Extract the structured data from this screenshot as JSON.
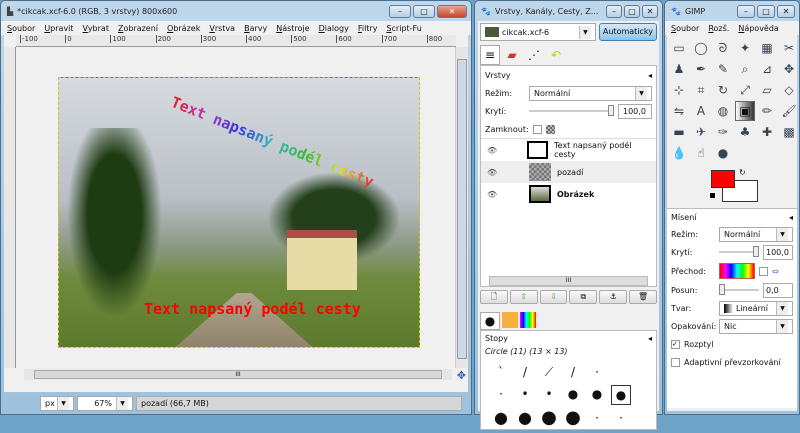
{
  "image_window": {
    "title": "*cikcak.xcf-6.0 (RGB, 3 vrstvy) 800x600",
    "menu": [
      "Soubor",
      "Upravit",
      "Vybrat",
      "Zobrazení",
      "Obrázek",
      "Vrstva",
      "Barvy",
      "Nástroje",
      "Dialogy",
      "Filtry",
      "Script-Fu"
    ],
    "ruler_labels": [
      "-100",
      "0",
      "100",
      "200",
      "300",
      "400",
      "500",
      "600",
      "700",
      "800"
    ],
    "canvas_text_arc": "Text napsaný podél cesty",
    "canvas_text_line": "Text napsaný podél cesty",
    "unit": "px",
    "zoom": "67%",
    "status": "pozadí (66,7 MB)"
  },
  "layers_window": {
    "title": "Vrstvy, Kanály, Cesty, Z...",
    "image_select": "cikcak.xcf-6",
    "auto_button": "Automaticky",
    "section": "Vrstvy",
    "mode_label": "Režim:",
    "mode": "Normální",
    "opacity_label": "Krytí:",
    "opacity": "100,0",
    "lock_label": "Zamknout:",
    "layers": [
      {
        "name": "Text napsaný podél cesty",
        "bold": false
      },
      {
        "name": "pozadí",
        "bold": false
      },
      {
        "name": "Obrázek",
        "bold": true
      }
    ],
    "brushes_title": "Stopy",
    "brush_name": "Circle (11) (13 × 13)"
  },
  "toolbox": {
    "title": "GIMP",
    "menu": [
      "Soubor",
      "Rozš.",
      "Nápověda"
    ],
    "fg_color": "#ff0000",
    "bg_color": "#ffffff",
    "tools": [
      "rect-select",
      "ellipse-select",
      "free-select",
      "fuzzy-select",
      "select-by-color",
      "scissors",
      "foreground-select",
      "paths",
      "color-picker",
      "zoom",
      "measure",
      "move",
      "align",
      "crop",
      "rotate",
      "scale",
      "shear",
      "perspective",
      "flip",
      "text",
      "bucket-fill",
      "blend",
      "pencil",
      "paintbrush",
      "eraser",
      "airbrush",
      "ink",
      "clone",
      "heal",
      "perspective-clone",
      "blur",
      "smudge",
      "dodge-burn"
    ],
    "tool_glyphs": [
      "▭",
      "◯",
      "ᘐ",
      "✦",
      "▦",
      "✂",
      "♟",
      "✒",
      "✎",
      "⌕",
      "⊿",
      "✥",
      "⊹",
      "⌗",
      "↻",
      "⤢",
      "▱",
      "◇",
      "⇋",
      "A",
      "◍",
      "▣",
      "✏",
      "🖌",
      "▬",
      "✈",
      "✑",
      "♣",
      "✚",
      "▩",
      "💧",
      "☝",
      "●"
    ],
    "options_title": "Mísení",
    "mode_label": "Režim:",
    "mode": "Normální",
    "opacity_label": "Krytí:",
    "opacity": "100,0",
    "gradient_label": "Přechod:",
    "offset_label": "Posun:",
    "offset": "0,0",
    "shape_label": "Tvar:",
    "shape": "Lineární",
    "repeat_label": "Opakování:",
    "repeat": "Nic",
    "dither_label": "Rozptyl",
    "dither": true,
    "adaptive_label": "Adaptivní převzorkování",
    "adaptive": false
  }
}
